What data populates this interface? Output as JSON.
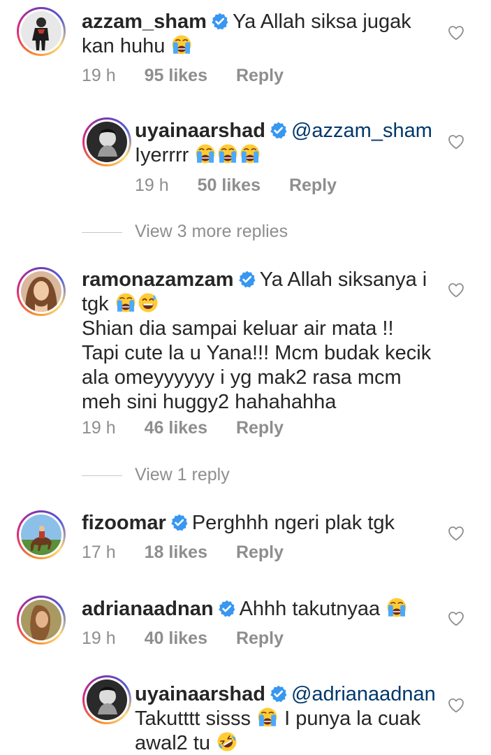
{
  "comments": [
    {
      "username": "azzam_sham",
      "text_lines": [
        "Ya Allah siksa jugak",
        "kan huhu"
      ],
      "time": "19 h",
      "likes": "95 likes",
      "reply": "Reply"
    },
    {
      "username": "uyainaarshad",
      "mention": "@azzam_sham",
      "text": "Iyerrrr",
      "time": "19 h",
      "likes": "50 likes",
      "reply": "Reply"
    },
    {
      "view_more": "View 3 more replies"
    },
    {
      "username": "ramonazamzam",
      "text_lines": [
        "Ya Allah siksanya i",
        "tgk",
        "Shian dia sampai keluar air mata !!",
        "Tapi cute la u Yana!!! Mcm budak kecik",
        "ala omeyyyyyy i yg mak2 rasa mcm",
        "meh sini huggy2 hahahahha"
      ],
      "time": "19 h",
      "likes": "46 likes",
      "reply": "Reply"
    },
    {
      "view_more": "View 1 reply"
    },
    {
      "username": "fizoomar",
      "text": "Perghhh ngeri plak tgk",
      "time": "17 h",
      "likes": "18 likes",
      "reply": "Reply"
    },
    {
      "username": "adrianaadnan",
      "text": "Ahhh takutnyaa",
      "time": "19 h",
      "likes": "40 likes",
      "reply": "Reply"
    },
    {
      "username": "uyainaarshad",
      "mention": "@adrianaadnan",
      "text_lines": [
        "Takutttt sisss",
        "I punya la cuak",
        "awal2 tu"
      ]
    }
  ],
  "colors": {
    "text": "#262626",
    "meta": "#8e8e8e",
    "mention": "#00376b",
    "verified": "#3897f0"
  },
  "icons": {
    "verified": "verified-badge-icon",
    "heart": "heart-outline-icon",
    "crying": "loudly-crying-face-emoji",
    "sweat_smile": "grinning-sweat-emoji",
    "rofl": "rolling-on-floor-laughing-emoji"
  }
}
